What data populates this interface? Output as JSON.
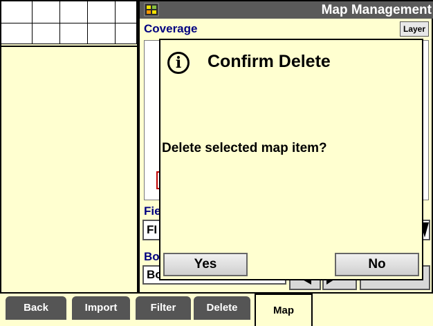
{
  "header": {
    "title": "Map Management",
    "icon": "display-icon"
  },
  "coverage": {
    "label": "Coverage",
    "layer_button": "Layer"
  },
  "fields": {
    "field_label": "Fie",
    "field_value": "FI",
    "boundary_label": "Bo",
    "boundary_value": "Bo"
  },
  "dialog": {
    "icon": "info-icon",
    "icon_glyph": "i",
    "title": "Confirm Delete",
    "message": "Delete selected map item?",
    "yes_label": "Yes",
    "no_label": "No"
  },
  "tabs": [
    {
      "label": "Back"
    },
    {
      "label": "Import"
    },
    {
      "label": "Filter"
    },
    {
      "label": "Delete"
    },
    {
      "label": "Map",
      "active": true
    }
  ],
  "colors": {
    "background": "#ffffd0",
    "titlebar": "#5a5a5a",
    "tab": "#555555",
    "accent": "#000080"
  }
}
